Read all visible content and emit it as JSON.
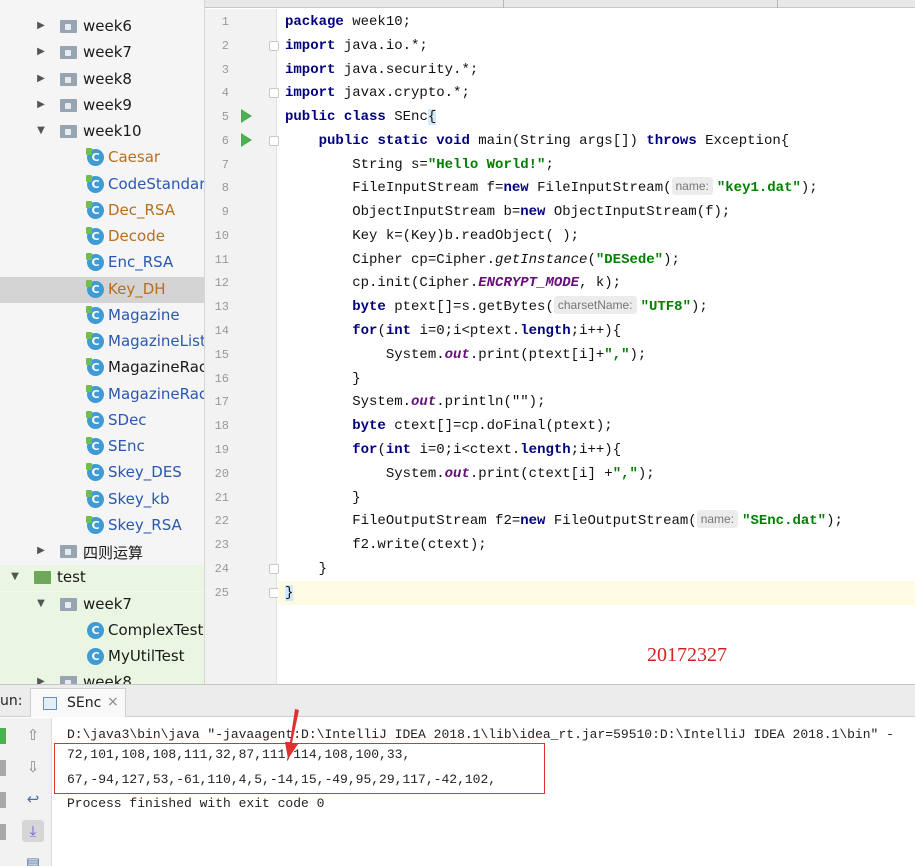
{
  "tree": {
    "items": [
      {
        "label": "week6",
        "kind": "folder",
        "expanded": false
      },
      {
        "label": "week7",
        "kind": "folder",
        "expanded": false
      },
      {
        "label": "week8",
        "kind": "folder",
        "expanded": false
      },
      {
        "label": "week9",
        "kind": "folder",
        "expanded": false
      },
      {
        "label": "week10",
        "kind": "folder",
        "expanded": true
      },
      {
        "label": "Caesar",
        "kind": "class",
        "status": "modified"
      },
      {
        "label": "CodeStandard",
        "kind": "class",
        "status": "new"
      },
      {
        "label": "Dec_RSA",
        "kind": "class",
        "status": "modified"
      },
      {
        "label": "Decode",
        "kind": "class",
        "status": "modified"
      },
      {
        "label": "Enc_RSA",
        "kind": "class",
        "status": "new"
      },
      {
        "label": "Key_DH",
        "kind": "class",
        "status": "modified",
        "selected": true
      },
      {
        "label": "Magazine",
        "kind": "class",
        "status": "new"
      },
      {
        "label": "MagazineList",
        "kind": "class",
        "status": "new"
      },
      {
        "label": "MagazineRack",
        "kind": "class",
        "status": "plain"
      },
      {
        "label": "MagazineRack",
        "kind": "class",
        "status": "new"
      },
      {
        "label": "SDec",
        "kind": "class",
        "status": "new"
      },
      {
        "label": "SEnc",
        "kind": "class",
        "status": "new"
      },
      {
        "label": "Skey_DES",
        "kind": "class",
        "status": "new"
      },
      {
        "label": "Skey_kb",
        "kind": "class",
        "status": "new"
      },
      {
        "label": "Skey_RSA",
        "kind": "class",
        "status": "new"
      },
      {
        "label": "四则运算",
        "kind": "folder",
        "expanded": false
      },
      {
        "label": "test",
        "kind": "src-folder",
        "expanded": true
      },
      {
        "label": "week7",
        "kind": "folder",
        "expanded": true
      },
      {
        "label": "ComplexTest",
        "kind": "class",
        "status": "plain"
      },
      {
        "label": "MyUtilTest",
        "kind": "class",
        "status": "plain"
      },
      {
        "label": "week8",
        "kind": "folder",
        "expanded": false
      }
    ]
  },
  "editor": {
    "line_numbers": [
      "1",
      "2",
      "3",
      "4",
      "5",
      "6",
      "7",
      "8",
      "9",
      "10",
      "11",
      "12",
      "13",
      "14",
      "15",
      "16",
      "17",
      "18",
      "19",
      "20",
      "21",
      "22",
      "23",
      "24",
      "25"
    ],
    "code": {
      "l1": {
        "kw": "package",
        "rest": " week10;"
      },
      "l2": {
        "kw": "import",
        "rest": " java.io.*;"
      },
      "l3": {
        "kw": "import",
        "rest": " java.security.*;"
      },
      "l4": {
        "kw": "import",
        "rest": " javax.crypto.*;"
      },
      "l5": {
        "kw1": "public",
        "kw2": "class",
        "name": " SEnc",
        "brace": "{"
      },
      "l6": {
        "kw1": "public",
        "kw2": "static",
        "kw3": "void",
        "mid": " main(String args[]) ",
        "kw4": "throws",
        "rest": " Exception{"
      },
      "l7": {
        "pre": "String s=",
        "str": "\"Hello World!\"",
        "post": ";"
      },
      "l8": {
        "pre": "FileInputStream f=",
        "kw": "new",
        "mid": " FileInputStream(",
        "hint": "name:",
        "str": "\"key1.dat\"",
        "post": ");"
      },
      "l9": {
        "pre": "ObjectInputStream b=",
        "kw": "new",
        "post": " ObjectInputStream(f);"
      },
      "l10": {
        "text": "Key k=(Key)b.readObject( );"
      },
      "l11": {
        "pre": "Cipher cp=Cipher.",
        "call": "getInstance",
        "mid": "(",
        "str": "\"DESede\"",
        "post": ");"
      },
      "l12": {
        "pre": "cp.init(Cipher.",
        "it": "ENCRYPT_MODE",
        "post": ", k);"
      },
      "l13": {
        "kw": "byte",
        "pre": " ptext[]=s.getBytes(",
        "hint": "charsetName:",
        "str": "\"UTF8\"",
        "post": ");"
      },
      "l14": {
        "kw1": "for",
        "mid1": "(",
        "kw2": "int",
        "mid2": " i=0;i<ptext.",
        "kw3": "length",
        "post": ";i++){"
      },
      "l15": {
        "pre": "System.",
        "it": "out",
        "mid": ".print(ptext[i]+",
        "str": "\",\"",
        "post": ");"
      },
      "l16": {
        "text": "}"
      },
      "l17": {
        "pre": "System.",
        "it": "out",
        "post": ".println(\"\");"
      },
      "l18": {
        "kw": "byte",
        "post": " ctext[]=cp.doFinal(ptext);"
      },
      "l19": {
        "kw1": "for",
        "mid1": "(",
        "kw2": "int",
        "mid2": " i=0;i<ctext.",
        "kw3": "length",
        "post": ";i++){"
      },
      "l20": {
        "pre": "System.",
        "it": "out",
        "mid": ".print(ctext[i] +",
        "str": "\",\"",
        "post": ");"
      },
      "l21": {
        "text": "}"
      },
      "l22": {
        "pre": "FileOutputStream f2=",
        "kw": "new",
        "mid": " FileOutputStream(",
        "hint": "name:",
        "str": "\"SEnc.dat\"",
        "post": ");"
      },
      "l23": {
        "text": "f2.write(ctext);"
      },
      "l24": {
        "text": "}"
      },
      "l25": {
        "text": "}"
      }
    },
    "overlay_text": "20172327"
  },
  "run_panel": {
    "label": "un:",
    "tab_label": "SEnc",
    "tab_close": "×",
    "console": [
      "D:\\java3\\bin\\java \"-javaagent:D:\\IntelliJ IDEA 2018.1\\lib\\idea_rt.jar=59510:D:\\IntelliJ IDEA 2018.1\\bin\" -",
      "72,101,108,108,111,32,87,111,114,108,100,33,",
      "67,-94,127,53,-61,110,4,5,-14,15,-49,95,29,117,-42,102,",
      "Process finished with exit code 0"
    ]
  },
  "colors": {
    "accent_red": "#e03030",
    "keyword": "#000080",
    "string": "#008000",
    "run_green": "#4caf50"
  }
}
